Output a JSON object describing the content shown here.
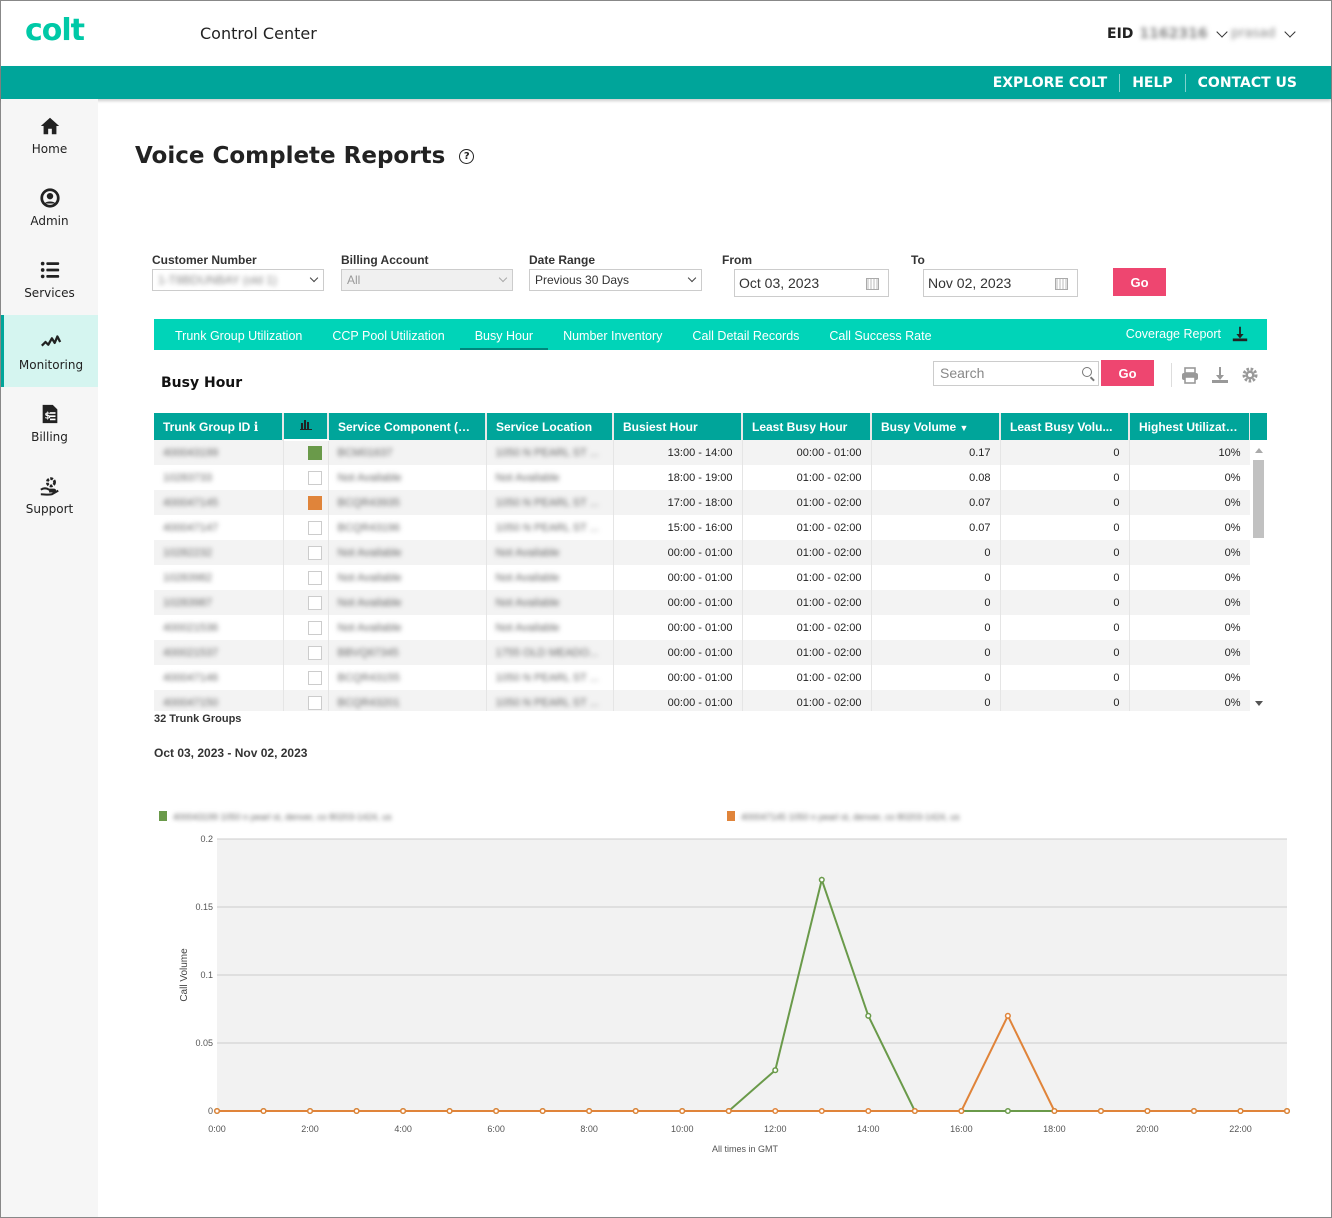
{
  "header": {
    "logo": "colt",
    "app_title": "Control Center",
    "eid_label": "EID",
    "eid_value": "1162316",
    "user_name": "prasad"
  },
  "topnav": {
    "items": [
      "EXPLORE COLT",
      "HELP",
      "CONTACT US"
    ]
  },
  "sidebar": {
    "items": [
      {
        "label": "Home",
        "icon": "home-icon"
      },
      {
        "label": "Admin",
        "icon": "user-circle-icon"
      },
      {
        "label": "Services",
        "icon": "list-icon"
      },
      {
        "label": "Monitoring",
        "icon": "pulse-icon",
        "active": true
      },
      {
        "label": "Billing",
        "icon": "invoice-icon"
      },
      {
        "label": "Support",
        "icon": "support-icon"
      }
    ]
  },
  "page": {
    "title": "Voice Complete Reports"
  },
  "filters": {
    "customer_number": {
      "label": "Customer Number",
      "value": "1-T8BDUNBAY (old 1)"
    },
    "billing_account": {
      "label": "Billing Account",
      "value": "All"
    },
    "date_range": {
      "label": "Date Range",
      "value": "Previous 30 Days"
    },
    "from": {
      "label": "From",
      "value": "Oct 03, 2023"
    },
    "to": {
      "label": "To",
      "value": "Nov 02, 2023"
    },
    "go_label": "Go"
  },
  "tabs": {
    "items": [
      "Trunk Group Utilization",
      "CCP Pool Utilization",
      "Busy Hour",
      "Number Inventory",
      "Call Detail Records",
      "Call Success Rate"
    ],
    "active": "Busy Hour",
    "coverage_report": "Coverage Report"
  },
  "section": {
    "title": "Busy Hour",
    "search_placeholder": "Search",
    "search_go": "Go"
  },
  "colors": {
    "teal_dark": "#00a59a",
    "teal_light": "#00d4b8",
    "go_pink": "#ee4670",
    "series_green": "#6a9a4a",
    "series_orange": "#e0843a"
  },
  "table": {
    "columns": [
      "Trunk Group ID",
      "",
      "Service Component (S...",
      "Service Location",
      "Busiest Hour",
      "Least Busy Hour",
      "Busy Volume",
      "Least Busy Volu...",
      "Highest Utilizatio..."
    ],
    "rows": [
      {
        "id": "400043199",
        "swatch": "green",
        "component": "BCM01637",
        "location": "1050 N PEARL ST ...",
        "busiest": "13:00 - 14:00",
        "least": "00:00 - 01:00",
        "busy_vol": "0.17",
        "least_vol": "0",
        "util": "10%"
      },
      {
        "id": "10283733",
        "swatch": "",
        "component": "Not Available",
        "location": "Not Available",
        "busiest": "18:00 - 19:00",
        "least": "01:00 - 02:00",
        "busy_vol": "0.08",
        "least_vol": "0",
        "util": "0%"
      },
      {
        "id": "400047145",
        "swatch": "orange",
        "component": "BCQR43935",
        "location": "1050 N PEARL ST ...",
        "busiest": "17:00 - 18:00",
        "least": "01:00 - 02:00",
        "busy_vol": "0.07",
        "least_vol": "0",
        "util": "0%"
      },
      {
        "id": "400047147",
        "swatch": "",
        "component": "BCQR43196",
        "location": "1050 N PEARL ST ...",
        "busiest": "15:00 - 16:00",
        "least": "01:00 - 02:00",
        "busy_vol": "0.07",
        "least_vol": "0",
        "util": "0%"
      },
      {
        "id": "10282232",
        "swatch": "",
        "component": "Not Available",
        "location": "Not Available",
        "busiest": "00:00 - 01:00",
        "least": "01:00 - 02:00",
        "busy_vol": "0",
        "least_vol": "0",
        "util": "0%"
      },
      {
        "id": "10283982",
        "swatch": "",
        "component": "Not Available",
        "location": "Not Available",
        "busiest": "00:00 - 01:00",
        "least": "01:00 - 02:00",
        "busy_vol": "0",
        "least_vol": "0",
        "util": "0%"
      },
      {
        "id": "10283987",
        "swatch": "",
        "component": "Not Available",
        "location": "Not Available",
        "busiest": "00:00 - 01:00",
        "least": "01:00 - 02:00",
        "busy_vol": "0",
        "least_vol": "0",
        "util": "0%"
      },
      {
        "id": "400021536",
        "swatch": "",
        "component": "Not Available",
        "location": "Not Available",
        "busiest": "00:00 - 01:00",
        "least": "01:00 - 02:00",
        "busy_vol": "0",
        "least_vol": "0",
        "util": "0%"
      },
      {
        "id": "400021537",
        "swatch": "",
        "component": "BBVQ67345",
        "location": "1755 OLD MEADO...",
        "busiest": "00:00 - 01:00",
        "least": "01:00 - 02:00",
        "busy_vol": "0",
        "least_vol": "0",
        "util": "0%"
      },
      {
        "id": "400047146",
        "swatch": "",
        "component": "BCQR43155",
        "location": "1050 N PEARL ST ...",
        "busiest": "00:00 - 01:00",
        "least": "01:00 - 02:00",
        "busy_vol": "0",
        "least_vol": "0",
        "util": "0%"
      },
      {
        "id": "400047150",
        "swatch": "",
        "component": "BCQR43201",
        "location": "1050 N PEARL ST ...",
        "busiest": "00:00 - 01:00",
        "least": "01:00 - 02:00",
        "busy_vol": "0",
        "least_vol": "0",
        "util": "0%"
      }
    ],
    "count_label": "32 Trunk Groups"
  },
  "date_range_label": "Oct 03, 2023 - Nov 02, 2023",
  "chart_data": {
    "type": "line",
    "title": "",
    "xlabel": "All times in GMT",
    "ylabel": "Call Volume",
    "ylim": [
      0,
      0.2
    ],
    "yticks": [
      "0",
      "0.05",
      "0.1",
      "0.15",
      "0.2"
    ],
    "xticks": [
      "0:00",
      "2:00",
      "4:00",
      "6:00",
      "8:00",
      "10:00",
      "12:00",
      "14:00",
      "16:00",
      "18:00",
      "20:00",
      "22:00"
    ],
    "x": [
      0,
      1,
      2,
      3,
      4,
      5,
      6,
      7,
      8,
      9,
      10,
      11,
      12,
      13,
      14,
      15,
      16,
      17,
      18,
      19,
      20,
      21,
      22,
      23
    ],
    "grid": true,
    "legend_position": "top",
    "series": [
      {
        "name": "400043199 1050 n pearl st, denver, co 80203-1424, us",
        "color": "#6a9a4a",
        "values": [
          0,
          0,
          0,
          0,
          0,
          0,
          0,
          0,
          0,
          0,
          0,
          0,
          0.03,
          0.17,
          0.07,
          0,
          0,
          0,
          0,
          0,
          0,
          0,
          0,
          0
        ]
      },
      {
        "name": "400047145 1050 n pearl st, denver, co 80203-1424, us",
        "color": "#e0843a",
        "values": [
          0,
          0,
          0,
          0,
          0,
          0,
          0,
          0,
          0,
          0,
          0,
          0,
          0,
          0,
          0,
          0,
          0,
          0.07,
          0,
          0,
          0,
          0,
          0,
          0
        ]
      }
    ]
  }
}
